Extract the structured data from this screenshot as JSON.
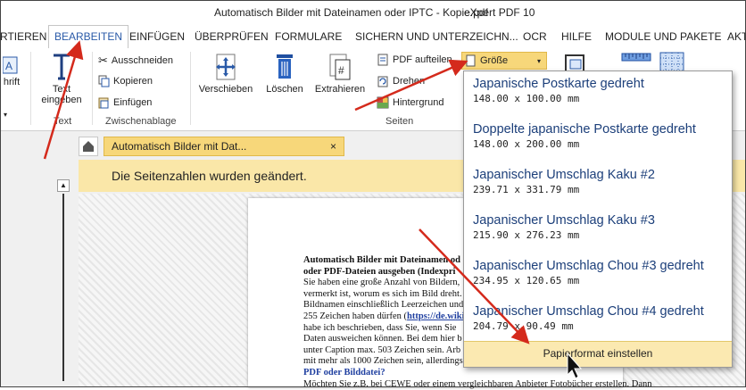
{
  "window": {
    "title": "Automatisch Bilder mit Dateinamen oder IPTC - Kopie.pdf",
    "app": "eXpert PDF 10"
  },
  "tabs": [
    "RTIEREN",
    "BEARBEITEN",
    "EINFÜGEN",
    "ÜBERPRÜFEN",
    "FORMULARE",
    "SICHERN UND UNTERZEICHN...",
    "OCR",
    "HILFE",
    "MODULE UND PAKETE",
    "AKT"
  ],
  "ribbon": {
    "schrift": "hrift",
    "text_eingeben_1": "Text",
    "text_eingeben_2": "eingeben",
    "group_text": "Text",
    "ausschneiden": "Ausschneiden",
    "kopieren": "Kopieren",
    "einfuegen": "Einfügen",
    "group_clipboard": "Zwischenablage",
    "verschieben": "Verschieben",
    "loeschen": "Löschen",
    "extrahieren": "Extrahieren",
    "pdf_aufteilen": "PDF aufteilen",
    "drehen": "Drehen",
    "hintergrund": "Hintergrund",
    "groesse": "Größe",
    "group_seiten": "Seiten"
  },
  "document_tab": {
    "label": "Automatisch Bilder mit Dat...",
    "close": "×"
  },
  "infobar": {
    "message": "Die Seitenzahlen wurden geändert."
  },
  "document": {
    "line1": "Automatisch Bilder mit Dateinamen od",
    "line2": "oder PDF-Dateien ausgeben (Indexpri",
    "line3": "Sie haben eine große Anzahl von Bildern,",
    "line4": "vermerkt ist, worum es sich im Bild dreht.",
    "line5": "Bildnamen einschließlich Leerzeichen und",
    "line6a": "255 Zeichen haben dürfen (",
    "line6b": "https://de.wiki",
    "line7": "habe ich beschrieben, dass Sie, wenn Sie",
    "line8": "Daten ausweichen können. Bei dem hier b",
    "line9": "unter Caption max. 503 Zeichen sein. Arb",
    "line10": "mit mehr als 1000 Zeichen sein, allerdings",
    "line11": "PDF oder Bilddatei?",
    "line12": "Möchten Sie z.B. bei CEWE oder einem vergleichbaren Anbieter Fotobücher erstellen. Dann"
  },
  "size_menu": {
    "items": [
      {
        "name": "Japanische Postkarte gedreht",
        "size": "148.00 x 100.00 mm"
      },
      {
        "name": "Doppelte japanische Postkarte gedreht",
        "size": "148.00 x 200.00 mm"
      },
      {
        "name": "Japanischer Umschlag Kaku #2",
        "size": "239.71 x 331.79 mm"
      },
      {
        "name": "Japanischer Umschlag Kaku #3",
        "size": "215.90 x 276.23 mm"
      },
      {
        "name": "Japanischer Umschlag Chou #3 gedreht",
        "size": "234.95 x 120.65 mm"
      },
      {
        "name": "Japanischer Umschlag Chou #4 gedreht",
        "size": "204.79 x 90.49 mm"
      }
    ],
    "footer": "Papierformat einstellen"
  },
  "colors": {
    "accent": "#2a5aa8",
    "annotation_arrow": "#d42a1c",
    "highlight": "#f7d77a"
  }
}
